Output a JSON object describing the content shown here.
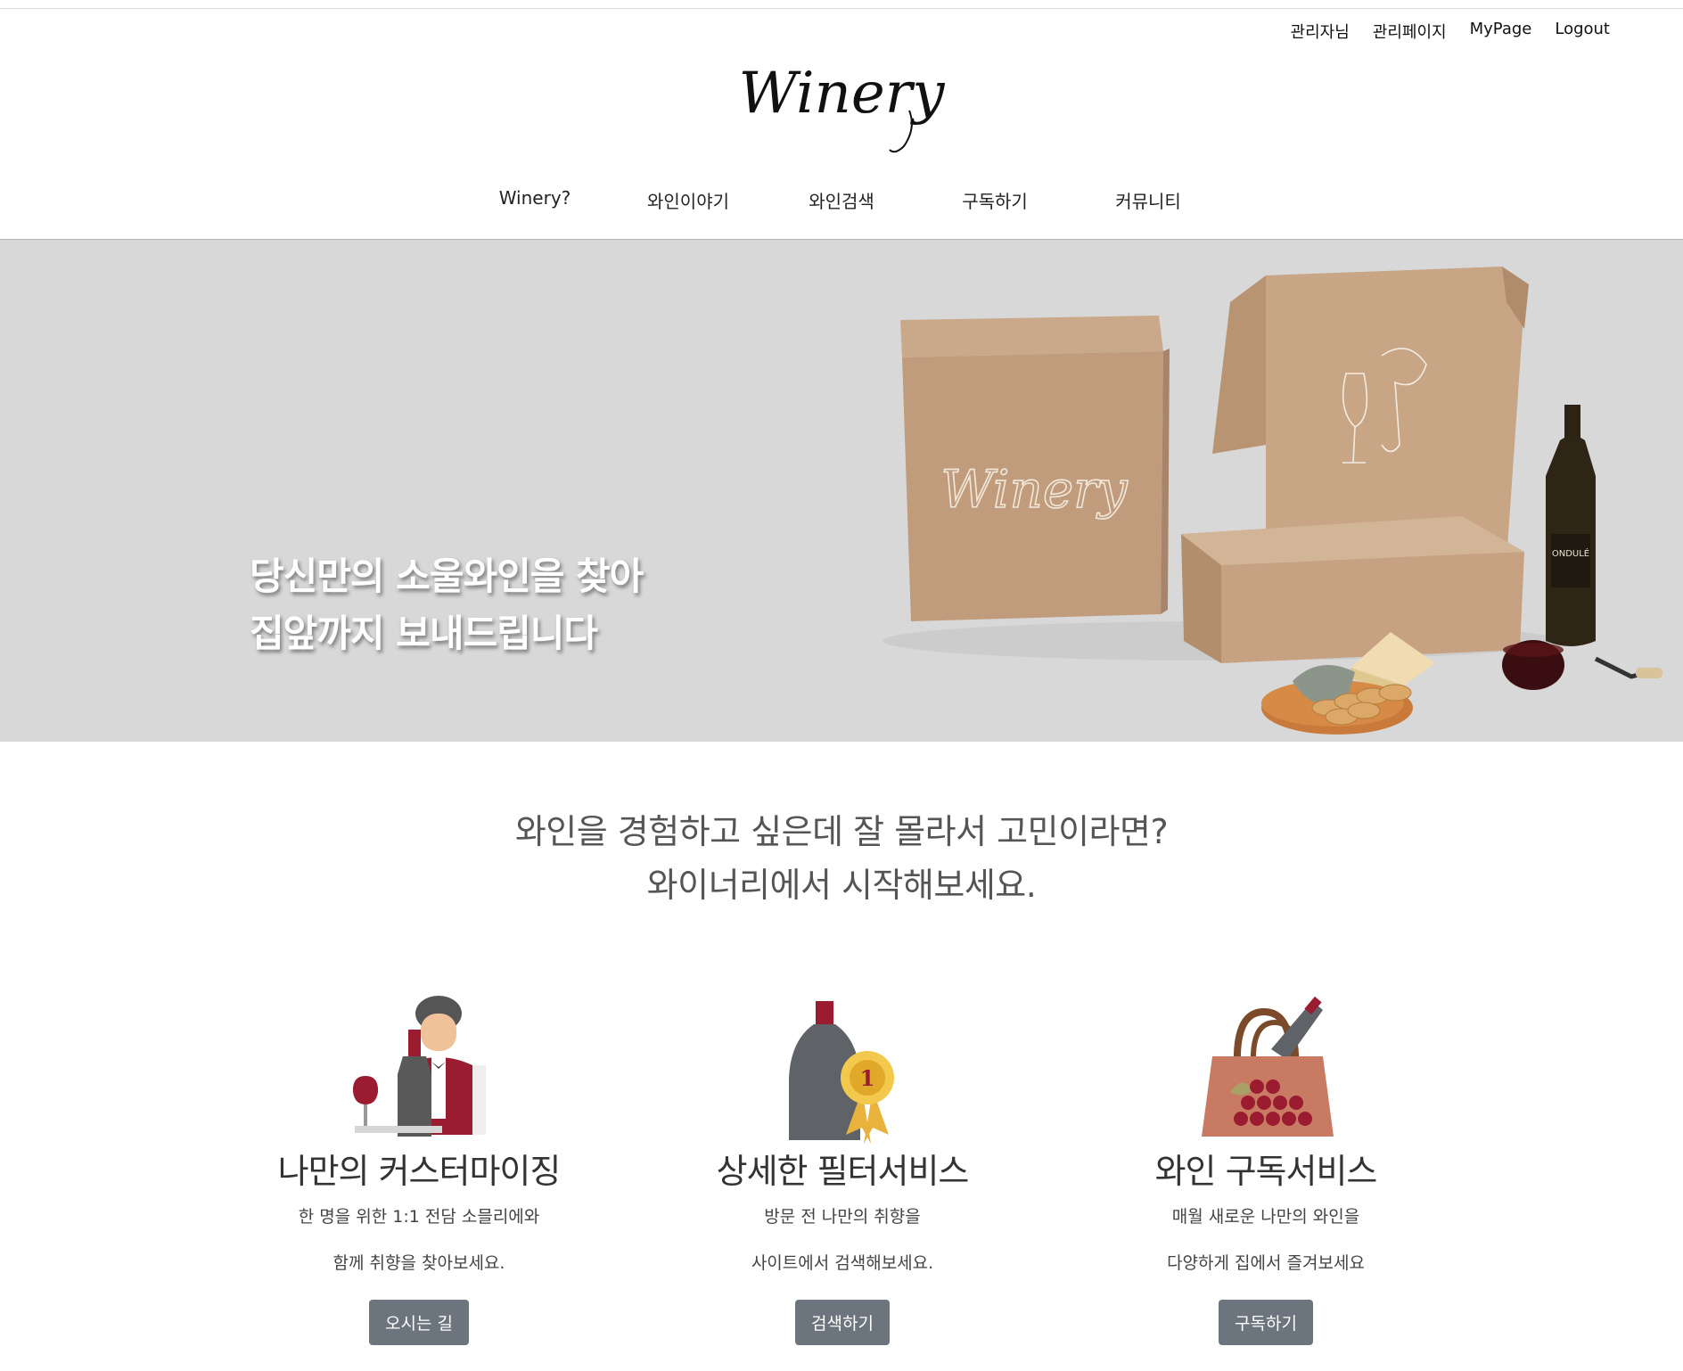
{
  "util_nav": [
    "관리자님",
    "관리페이지",
    "MyPage",
    "Logout"
  ],
  "logo": "Winery",
  "main_nav": [
    "Winery?",
    "와인이야기",
    "와인검색",
    "구독하기",
    "커뮤니티"
  ],
  "hero": {
    "line1": "당신만의 소울와인을 찾아",
    "line2": "집앞까지 보내드립니다",
    "box_logo": "Winery",
    "bottle_label": "ONDULÉ"
  },
  "intro": {
    "line1": "와인을 경험하고 싶은데 잘 몰라서 고민이라면?",
    "line2": "와이너리에서 시작해보세요."
  },
  "features": [
    {
      "icon": "sommelier-icon",
      "title": "나만의 커스터마이징",
      "desc1": "한 명을 위한 1:1 전담 소믈리에와",
      "desc2": "함께 취향을 찾아보세요.",
      "button": "오시는 길"
    },
    {
      "icon": "award-bottle-icon",
      "title": "상세한 필터서비스",
      "desc1": "방문 전 나만의 취향을",
      "desc2": "사이트에서 검색해보세요.",
      "button": "검색하기"
    },
    {
      "icon": "wine-bag-icon",
      "title": "와인 구독서비스",
      "desc1": "매월 새로운 나만의 와인을",
      "desc2": "다양하게 집에서 즐겨보세요",
      "button": "구독하기"
    }
  ],
  "colors": {
    "wine": "#9b1b30",
    "button": "#6c757d",
    "hero_bg": "#d8d8d8"
  }
}
